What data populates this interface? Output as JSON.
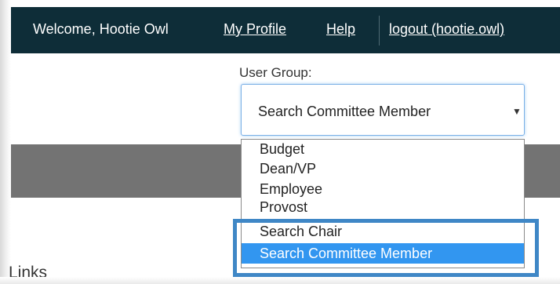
{
  "header": {
    "welcome": "Welcome, Hootie Owl",
    "my_profile": "My Profile",
    "help": "Help",
    "logout": "logout (hootie.owl)"
  },
  "user_group": {
    "label": "User Group:",
    "selected_value": "Search Committee Member",
    "options": [
      "Budget",
      "Dean/VP",
      "Employee",
      "Provost",
      "Search Chair",
      "Search Committee Member"
    ]
  },
  "links": {
    "heading": "Links"
  },
  "colors": {
    "header_bg": "#0e2d38",
    "selected_option_bg": "#3296f0",
    "highlight_border": "#3f87c6",
    "gray_band": "#737373"
  }
}
